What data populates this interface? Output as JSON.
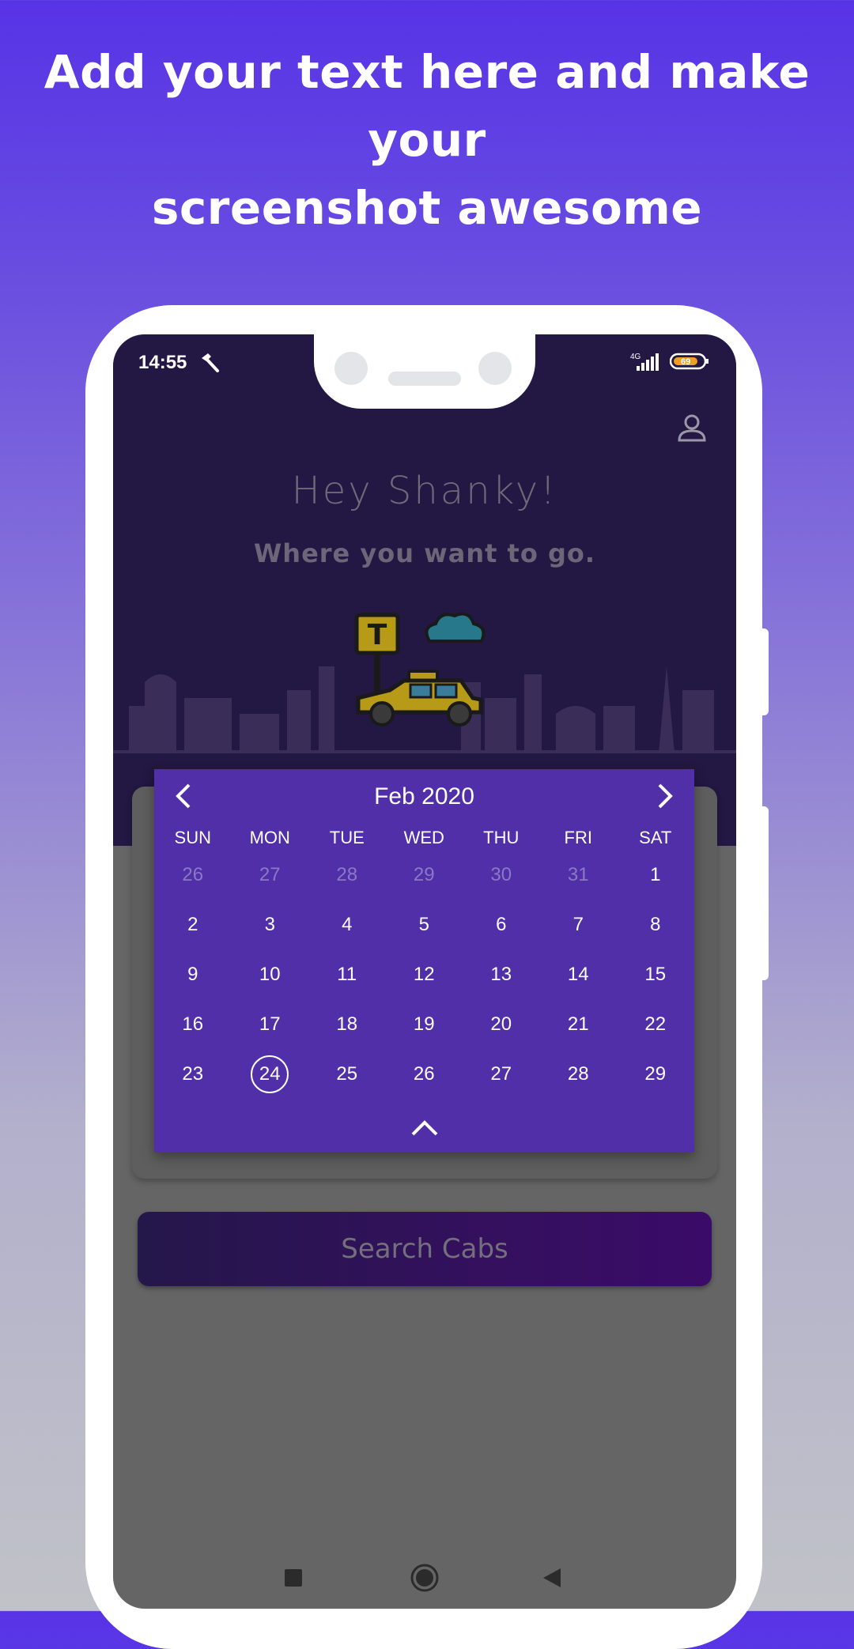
{
  "promo": {
    "line1": "Add your text here and make your",
    "line2": "screenshot awesome"
  },
  "status_bar": {
    "time": "14:55",
    "network": "4G",
    "battery": "69"
  },
  "hero": {
    "greeting": "Hey Shanky!",
    "subtitle": "Where you want to go."
  },
  "calendar": {
    "month_label": "Feb 2020",
    "weekdays": [
      "SUN",
      "MON",
      "TUE",
      "WED",
      "THU",
      "FRI",
      "SAT"
    ],
    "weeks": [
      [
        "26",
        "27",
        "28",
        "29",
        "30",
        "31",
        "1"
      ],
      [
        "2",
        "3",
        "4",
        "5",
        "6",
        "7",
        "8"
      ],
      [
        "9",
        "10",
        "11",
        "12",
        "13",
        "14",
        "15"
      ],
      [
        "16",
        "17",
        "18",
        "19",
        "20",
        "21",
        "22"
      ],
      [
        "23",
        "24",
        "25",
        "26",
        "27",
        "28",
        "29"
      ]
    ],
    "muted_days_in_first_week": 6,
    "selected_day": "24"
  },
  "search_button": {
    "label": "Search Cabs"
  },
  "icons": {
    "profile": "profile-icon",
    "prev": "chevron-left-icon",
    "next": "chevron-right-icon",
    "collapse": "chevron-up-icon",
    "nav_recent": "square-icon",
    "nav_home": "circle-icon",
    "nav_back": "triangle-back-icon"
  },
  "colors": {
    "calendar_bg": "#502fa9",
    "hero_bg": "#231743",
    "page_gradient_top": "#5733e6"
  }
}
